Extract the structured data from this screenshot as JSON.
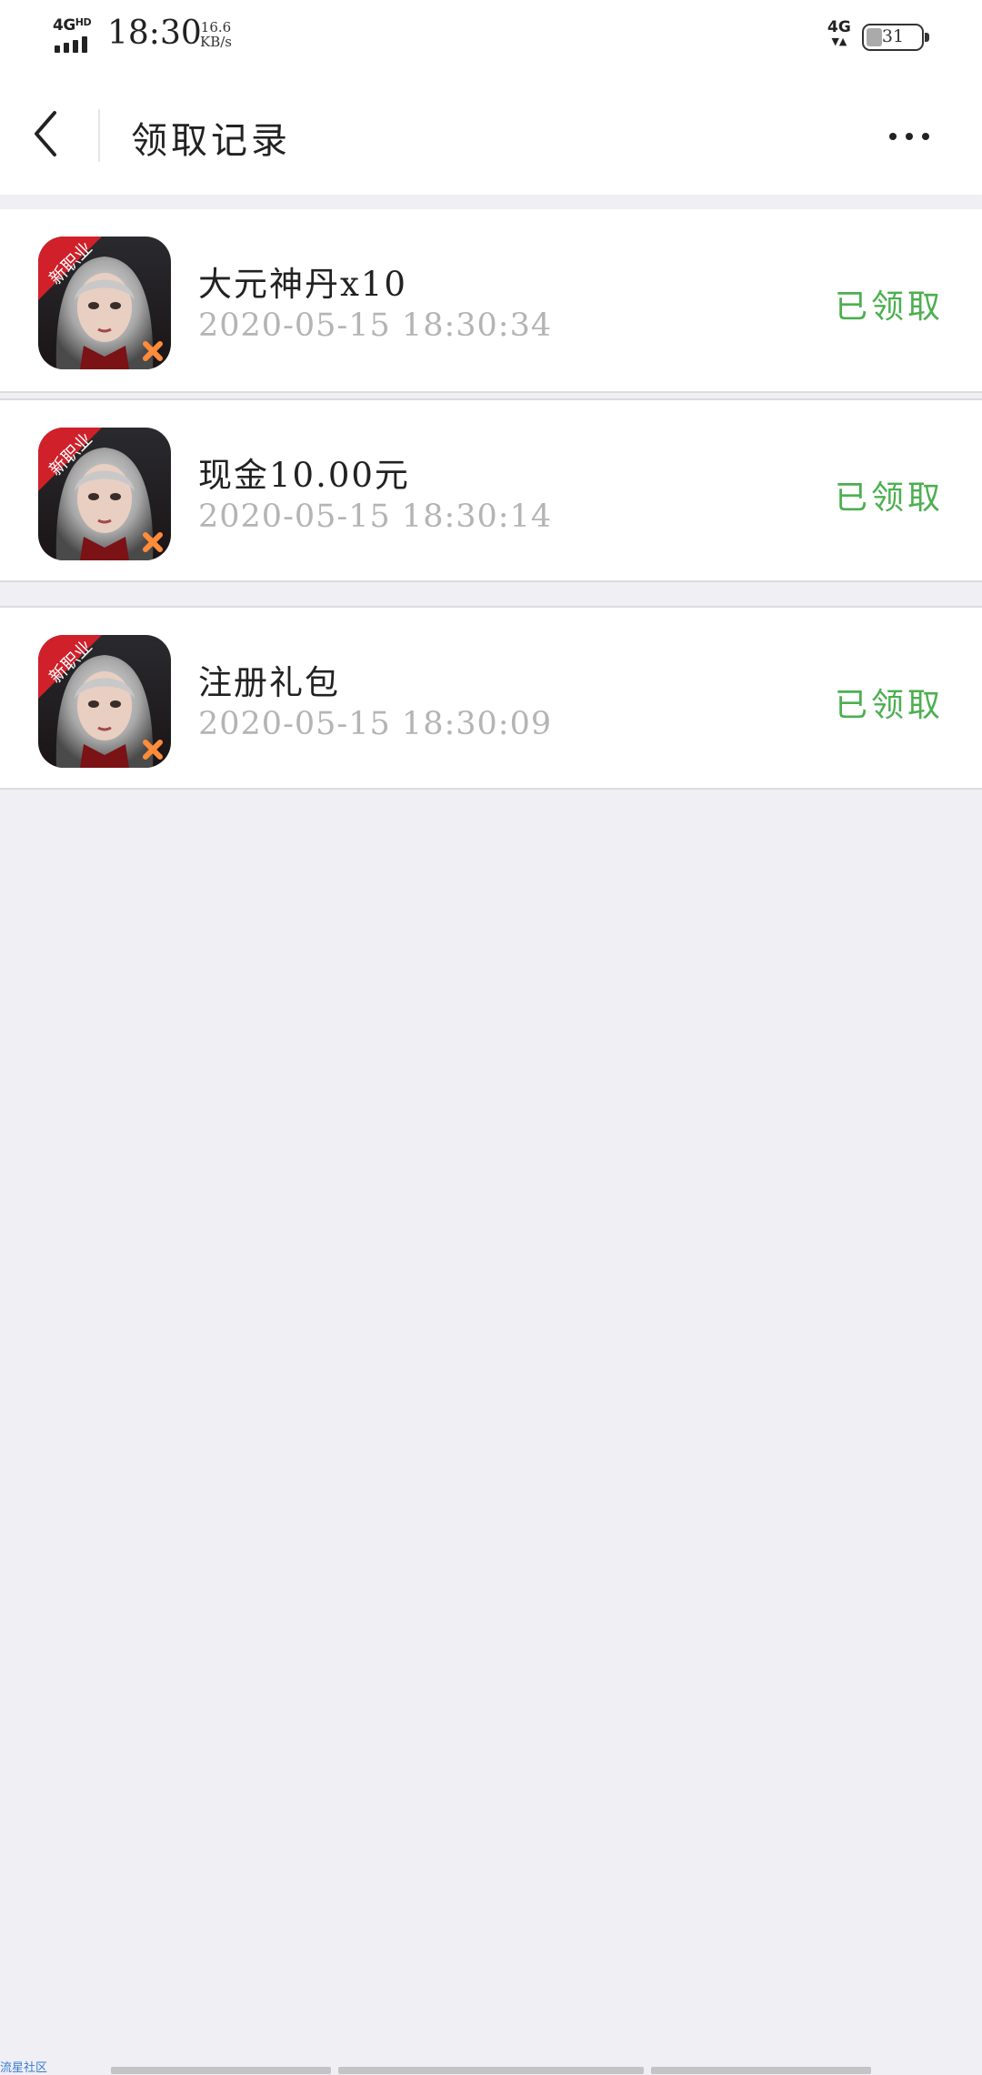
{
  "status_bar": {
    "network_type": "4G",
    "network_sup": "HD",
    "time": "18:30",
    "speed_value": "16.6",
    "speed_unit": "KB/s",
    "right_network": "4G",
    "battery_level": "31"
  },
  "nav": {
    "back_icon": "chevron-left-icon",
    "title": "领取记录",
    "more_icon": "more-dots-icon"
  },
  "records": [
    {
      "name": "大元神丹x10",
      "time": "2020-05-15 18:30:34",
      "status": "已领取",
      "badge": "新职业"
    },
    {
      "name": "现金10.00元",
      "time": "2020-05-15 18:30:14",
      "status": "已领取",
      "badge": "新职业"
    },
    {
      "name": "注册礼包",
      "time": "2020-05-15 18:30:09",
      "status": "已领取",
      "badge": "新职业"
    }
  ],
  "colors": {
    "status_green": "#4caf50",
    "background": "#efeff4",
    "timestamp_gray": "#b4b4b4",
    "badge_red": "#d0202a"
  },
  "watermark": "流星社区"
}
